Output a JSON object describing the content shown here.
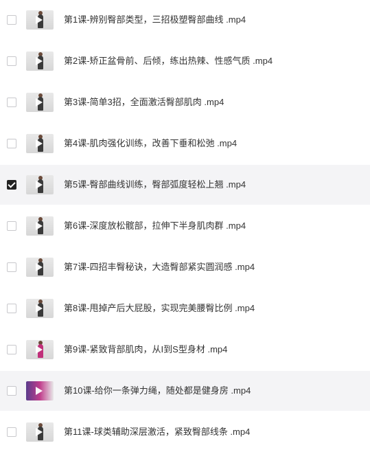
{
  "files": [
    {
      "title": "第1课-辨别臀部类型，三招极塑臀部曲线 .mp4",
      "checked": false,
      "highlighted": false,
      "thumb": "video-thumbnail"
    },
    {
      "title": "第2课-矫正盆骨前、后倾，练出热辣、性感气质 .mp4",
      "checked": false,
      "highlighted": false,
      "thumb": "video-thumbnail"
    },
    {
      "title": "第3课-简单3招，全面激活臀部肌肉 .mp4",
      "checked": false,
      "highlighted": false,
      "thumb": "video-thumbnail"
    },
    {
      "title": "第4课-肌肉强化训练，改善下垂和松弛 .mp4",
      "checked": false,
      "highlighted": false,
      "thumb": "video-thumbnail"
    },
    {
      "title": "第5课-臀部曲线训练，臀部弧度轻松上翘 .mp4",
      "checked": true,
      "highlighted": true,
      "thumb": "video-thumbnail"
    },
    {
      "title": "第6课-深度放松髋部，拉伸下半身肌肉群 .mp4",
      "checked": false,
      "highlighted": false,
      "thumb": "video-thumbnail"
    },
    {
      "title": "第7课-四招丰臀秘诀，大造臀部紧实圆润感 .mp4",
      "checked": false,
      "highlighted": false,
      "thumb": "video-thumbnail"
    },
    {
      "title": "第8课-甩掉产后大屁股，实现完美腰臀比例 .mp4",
      "checked": false,
      "highlighted": false,
      "thumb": "video-thumbnail"
    },
    {
      "title": "第9课-紧致背部肌肉，从I到S型身材 .mp4",
      "checked": false,
      "highlighted": false,
      "thumb": "video-thumbnail"
    },
    {
      "title": "第10课-给你一条弹力绳，随处都是健身房 .mp4",
      "checked": false,
      "highlighted": true,
      "thumb": "video-thumbnail"
    },
    {
      "title": "第11课-球类辅助深层激活，紧致臀部线条 .mp4",
      "checked": false,
      "highlighted": false,
      "thumb": "video-thumbnail"
    }
  ]
}
